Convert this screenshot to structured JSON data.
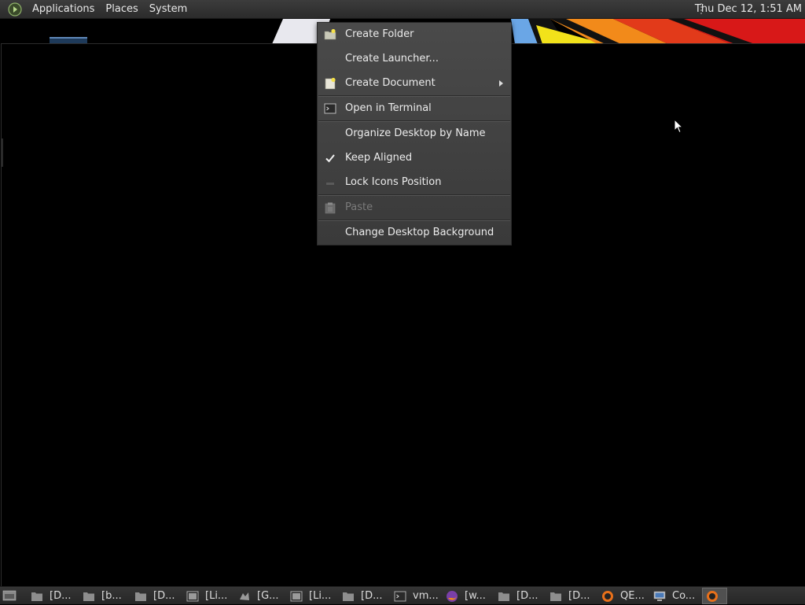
{
  "top_panel": {
    "menus": [
      "Applications",
      "Places",
      "System"
    ],
    "clock": "Thu Dec 12,  1:51 AM"
  },
  "context_menu": {
    "items": [
      {
        "label": "Create Folder",
        "icon": "folder-new-icon",
        "enabled": true
      },
      {
        "label": "Create Launcher...",
        "icon": "",
        "enabled": true
      },
      {
        "label": "Create Document",
        "icon": "document-new-icon",
        "enabled": true,
        "submenu": true
      },
      {
        "label": "Open in Terminal",
        "icon": "terminal-icon",
        "enabled": true
      },
      {
        "label": "Organize Desktop by Name",
        "icon": "",
        "enabled": true
      },
      {
        "label": "Keep Aligned",
        "icon": "checkmark-icon",
        "enabled": true,
        "checked": true
      },
      {
        "label": "Lock Icons Position",
        "icon": "lock-icon",
        "enabled": true
      },
      {
        "label": "Paste",
        "icon": "paste-icon",
        "enabled": false
      },
      {
        "label": "Change Desktop Background",
        "icon": "",
        "enabled": true
      }
    ]
  },
  "taskbar": {
    "tasks": [
      {
        "label": "[D...",
        "icon": "folder-icon"
      },
      {
        "label": "[b...",
        "icon": "folder-icon"
      },
      {
        "label": "[D...",
        "icon": "folder-icon"
      },
      {
        "label": "[Li...",
        "icon": "terminal-icon"
      },
      {
        "label": "[G...",
        "icon": "gimp-icon"
      },
      {
        "label": "[Li...",
        "icon": "terminal-icon"
      },
      {
        "label": "[D...",
        "icon": "folder-icon"
      },
      {
        "label": "vm...",
        "icon": "terminal-icon"
      },
      {
        "label": "[w...",
        "icon": "firefox-icon"
      },
      {
        "label": "[D...",
        "icon": "folder-icon"
      },
      {
        "label": "[D...",
        "icon": "folder-icon"
      },
      {
        "label": "QE...",
        "icon": "qemu-icon"
      },
      {
        "label": "Co...",
        "icon": "computer-icon"
      },
      {
        "label": "",
        "icon": "qemu-icon",
        "active": true
      }
    ]
  },
  "colors": {
    "panel": "#2b2b2b",
    "menu_bg": "#404040",
    "desktop": "#000000"
  }
}
